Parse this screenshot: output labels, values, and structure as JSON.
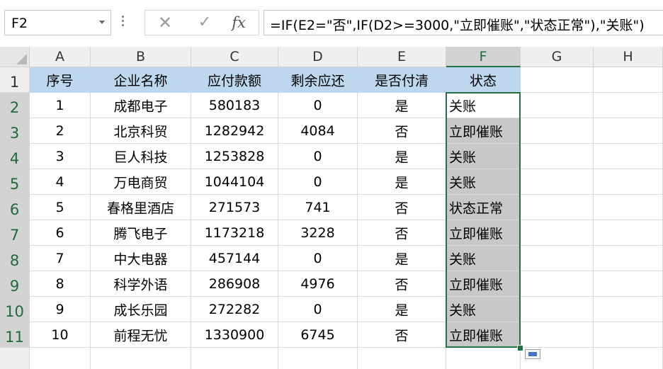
{
  "formula_bar": {
    "name_box": "F2",
    "cancel_glyph": "✕",
    "enter_glyph": "✓",
    "fx_label": "fx",
    "formula": "=IF(E2=\"否\",IF(D2>=3000,\"立即催账\",\"状态正常\"),\"关账\")"
  },
  "columns": [
    "A",
    "B",
    "C",
    "D",
    "E",
    "F",
    "G",
    "H"
  ],
  "active_column": "F",
  "active_cell": "F2",
  "header_row": [
    "序号",
    "企业名称",
    "应付款额",
    "剩余应还",
    "是否付清",
    "状态"
  ],
  "rows": [
    [
      "1",
      "成都电子",
      "580183",
      "0",
      "是",
      "关账"
    ],
    [
      "2",
      "北京科贸",
      "1282942",
      "4084",
      "否",
      "立即催账"
    ],
    [
      "3",
      "巨人科技",
      "1253828",
      "0",
      "是",
      "关账"
    ],
    [
      "4",
      "万电商贸",
      "1044104",
      "0",
      "是",
      "关账"
    ],
    [
      "5",
      "春格里酒店",
      "271573",
      "741",
      "否",
      "状态正常"
    ],
    [
      "6",
      "腾飞电子",
      "1173218",
      "3228",
      "否",
      "立即催账"
    ],
    [
      "7",
      "中大电器",
      "457144",
      "0",
      "是",
      "关账"
    ],
    [
      "8",
      "科学外语",
      "286908",
      "4976",
      "否",
      "立即催账"
    ],
    [
      "9",
      "成长乐园",
      "272282",
      "0",
      "是",
      "关账"
    ],
    [
      "10",
      "前程无忧",
      "1330900",
      "6745",
      "否",
      "立即催账"
    ]
  ],
  "row_numbers": [
    "1",
    "2",
    "3",
    "4",
    "5",
    "6",
    "7",
    "8",
    "9",
    "10",
    "11"
  ],
  "colors": {
    "header_fill": "#bdd7ee",
    "selection_fill": "#c8c8c8",
    "accent": "#217346"
  },
  "icons": [
    "dropdown-arrow-icon",
    "more-dots-icon",
    "cancel-icon",
    "enter-icon",
    "insert-function-icon",
    "select-all-icon",
    "quick-analysis-icon"
  ]
}
